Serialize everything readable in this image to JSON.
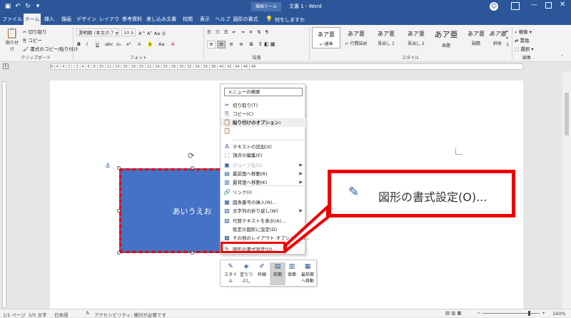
{
  "titlebar": {
    "tool_context": "描画ツール",
    "doc_title": "文書 1 - Word",
    "user_initial": "",
    "icons": [
      "save-icon",
      "undo-icon",
      "redo-icon",
      "customize-icon"
    ]
  },
  "tabs": [
    "ファイル",
    "ホーム",
    "挿入",
    "描画",
    "デザイン",
    "レイアウト",
    "参考資料",
    "差し込み文書",
    "校閲",
    "表示",
    "ヘルプ",
    "図形の書式"
  ],
  "tell_me": "何をしますか",
  "ribbon": {
    "clipboard": {
      "paste": "貼り付け",
      "cut": "切り取り",
      "copy": "コピー",
      "format_painter": "書式のコピー/貼り付け",
      "label": "クリップボード"
    },
    "font": {
      "font_name": "游明朝 (本文のフォ",
      "font_size": "10.5",
      "label": "フォント",
      "buttons": [
        "B",
        "I",
        "U",
        "abc",
        "x₂",
        "x²",
        "A",
        "A",
        "Aa",
        "A"
      ]
    },
    "paragraph": {
      "label": "段落"
    },
    "styles": {
      "label": "スタイル",
      "items": [
        {
          "sample": "あア亜",
          "name": "↵ 標準"
        },
        {
          "sample": "あア亜",
          "name": "↵ 行間詰め"
        },
        {
          "sample": "あア亜",
          "name": "見出し 1"
        },
        {
          "sample": "あア亜",
          "name": "見出し 2"
        },
        {
          "sample": "あア亜",
          "name": "表題"
        },
        {
          "sample": "あア亜",
          "name": "副題"
        },
        {
          "sample": "あア亜",
          "name": "斜体"
        }
      ]
    },
    "editing": {
      "label": "編集",
      "find": "検索",
      "replace": "置換",
      "select": "選択"
    }
  },
  "ruler": {
    "text": "8 | 6 | 4 | 2 |   | 2 | 4 | 6 | 8 | 10 | 12 | 14 | 16 | 18 | 20 | 22 | 24 | 26 | 28 | 30 | 32 | 34 | 36 | 38 | 40 | 42 | 44 | 46 | 48"
  },
  "shape": {
    "text": "あいうえお"
  },
  "context_menu": {
    "search": "メニューの検索",
    "items": [
      {
        "icon": "cut-icon",
        "glyph": "✂",
        "label": "切り取り(T)",
        "state": "normal",
        "submenu": false
      },
      {
        "icon": "copy-icon",
        "glyph": "⎘",
        "label": "コピー(C)",
        "state": "normal",
        "submenu": false
      },
      {
        "icon": "paste-options-icon",
        "glyph": "📋",
        "label": "貼り付けのオプション:",
        "state": "header",
        "submenu": false
      },
      {
        "icon": "paste-keep-icon",
        "glyph": "📋",
        "label": "",
        "state": "normal",
        "submenu": false
      },
      {
        "icon": "add-text-icon",
        "glyph": "A",
        "label": "テキストの追加(X)",
        "state": "normal",
        "submenu": false
      },
      {
        "icon": "edit-points-icon",
        "glyph": "⬚",
        "label": "頂点の編集(E)",
        "state": "normal",
        "submenu": false
      },
      {
        "icon": "group-icon",
        "glyph": "▣",
        "label": "グループ化(G)",
        "state": "disabled",
        "submenu": true
      },
      {
        "icon": "bring-front-icon",
        "glyph": "▤",
        "label": "最前面へ移動(R)",
        "state": "normal",
        "submenu": true
      },
      {
        "icon": "send-back-icon",
        "glyph": "▥",
        "label": "最背面へ移動(K)",
        "state": "normal",
        "submenu": true
      },
      {
        "icon": "link-icon",
        "glyph": "🔗",
        "label": "リンク(I)",
        "state": "normal",
        "submenu": false
      },
      {
        "icon": "caption-icon",
        "glyph": "▦",
        "label": "図表番号の挿入(N)...",
        "state": "normal",
        "submenu": false
      },
      {
        "icon": "wrap-text-icon",
        "glyph": "▧",
        "label": "文字列の折り返し(W)",
        "state": "normal",
        "submenu": true
      },
      {
        "icon": "alt-text-icon",
        "glyph": "▨",
        "label": "代替テキストを表示(A)...",
        "state": "normal",
        "submenu": false
      },
      {
        "icon": "set-default-icon",
        "glyph": "",
        "label": "既定の図形に設定(D)",
        "state": "normal",
        "submenu": false
      },
      {
        "icon": "layout-options-icon",
        "glyph": "▩",
        "label": "その他のレイアウト オプション(L)...",
        "state": "normal",
        "submenu": false
      },
      {
        "icon": "format-shape-icon",
        "glyph": "✎",
        "label": "図形の書式設定(O)...",
        "state": "normal",
        "submenu": false
      }
    ]
  },
  "mini_toolbar": {
    "buttons": [
      {
        "icon": "style-icon",
        "glyph": "✎",
        "label": "スタイル"
      },
      {
        "icon": "fill-icon",
        "glyph": "◈",
        "label": "塗りつぶし"
      },
      {
        "icon": "outline-icon",
        "glyph": "✐",
        "label": "枠線"
      },
      {
        "icon": "front-icon",
        "glyph": "▤",
        "label": "前面"
      },
      {
        "icon": "back-icon",
        "glyph": "▥",
        "label": "背面"
      },
      {
        "icon": "wrap-icon",
        "glyph": "▦",
        "label": "最前面へ移動"
      }
    ]
  },
  "callout": {
    "text": "図形の書式設定(O)..."
  },
  "statusbar": {
    "page": "1/1 ページ",
    "words": "5/5 文字",
    "language": "日本語",
    "accessibility": "アクセシビリティ: 検討が必要です",
    "zoom": "160%"
  },
  "colors": {
    "brand": "#2b579a",
    "shape_fill": "#4472c4",
    "highlight": "#e00000"
  }
}
